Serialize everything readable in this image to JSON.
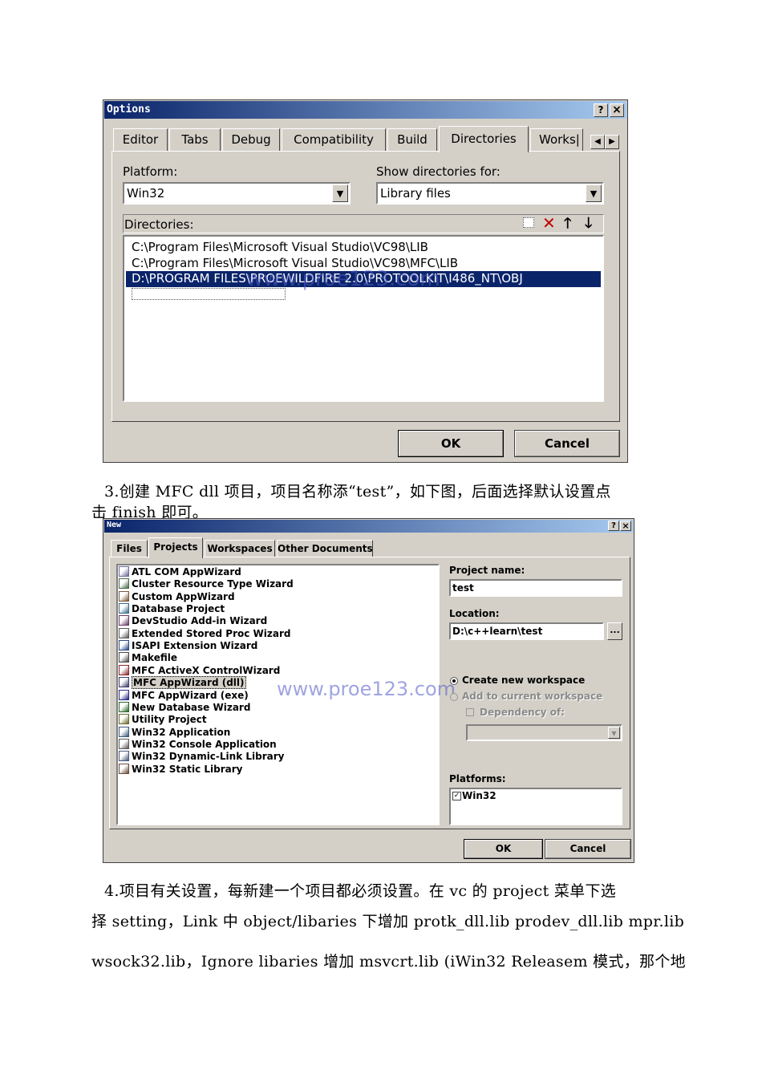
{
  "options_dialog": {
    "title": "Options",
    "help_btn": "?",
    "close_btn": "×",
    "tabs": [
      "Editor",
      "Tabs",
      "Debug",
      "Compatibility",
      "Build",
      "Directories",
      "Works|"
    ],
    "active_tab": "Directories",
    "platform_label": "Platform:",
    "platform_value": "Win32",
    "show_dirs_label": "Show directories for:",
    "show_dirs_value": "Library files",
    "directories_label": "Directories:",
    "dirs": [
      "C:\\Program Files\\Microsoft Visual Studio\\VC98\\LIB",
      "C:\\Program Files\\Microsoft Visual Studio\\VC98\\MFC\\LIB",
      "D:\\PROGRAM FILES\\PROEWILDFIRE 2.0\\PROTOOLKIT\\I486_NT\\OBJ"
    ],
    "watermark": "www.proe123.com",
    "ok": "OK",
    "cancel": "Cancel"
  },
  "para1": {
    "line1": "3.创建 MFC dll 项目，项目名称添“test”，如下图，后面选择默认设置点",
    "line2": "击 finish 即可。"
  },
  "new_dialog": {
    "title": "New",
    "help_btn": "?",
    "close_btn": "×",
    "tabs": [
      "Files",
      "Projects",
      "Workspaces",
      "Other Documents"
    ],
    "active_tab": "Projects",
    "projects": [
      "ATL COM AppWizard",
      "Cluster Resource Type Wizard",
      "Custom AppWizard",
      "Database Project",
      "DevStudio Add-in Wizard",
      "Extended Stored Proc Wizard",
      "ISAPI Extension Wizard",
      "Makefile",
      "MFC ActiveX ControlWizard",
      "MFC AppWizard (dll)",
      "MFC AppWizard (exe)",
      "New Database Wizard",
      "Utility Project",
      "Win32 Application",
      "Win32 Console Application",
      "Win32 Dynamic-Link Library",
      "Win32 Static Library"
    ],
    "selected_project": "MFC AppWizard (dll)",
    "project_name_label": "Project name:",
    "project_name_value": "test",
    "location_label": "Location:",
    "location_value": "D:\\c++learn\\test",
    "browse": "...",
    "create_new": "Create new workspace",
    "add_current": "Add to current workspace",
    "dependency": "Dependency of:",
    "platforms_label": "Platforms:",
    "platform_item": "Win32",
    "watermark": "www.proe123.com",
    "ok": "OK",
    "cancel": "Cancel"
  },
  "para2": {
    "line1": "4.项目有关设置，每新建一个项目都必须设置。在 vc 的 project 菜单下选",
    "line2": "择 setting，Link 中 object/libaries 下增加 protk_dll.lib prodev_dll.lib mpr.lib",
    "line3": "wsock32.lib，Ignore libaries 增加 msvcrt.lib (iWin32 Releasem 模式，那个地"
  }
}
